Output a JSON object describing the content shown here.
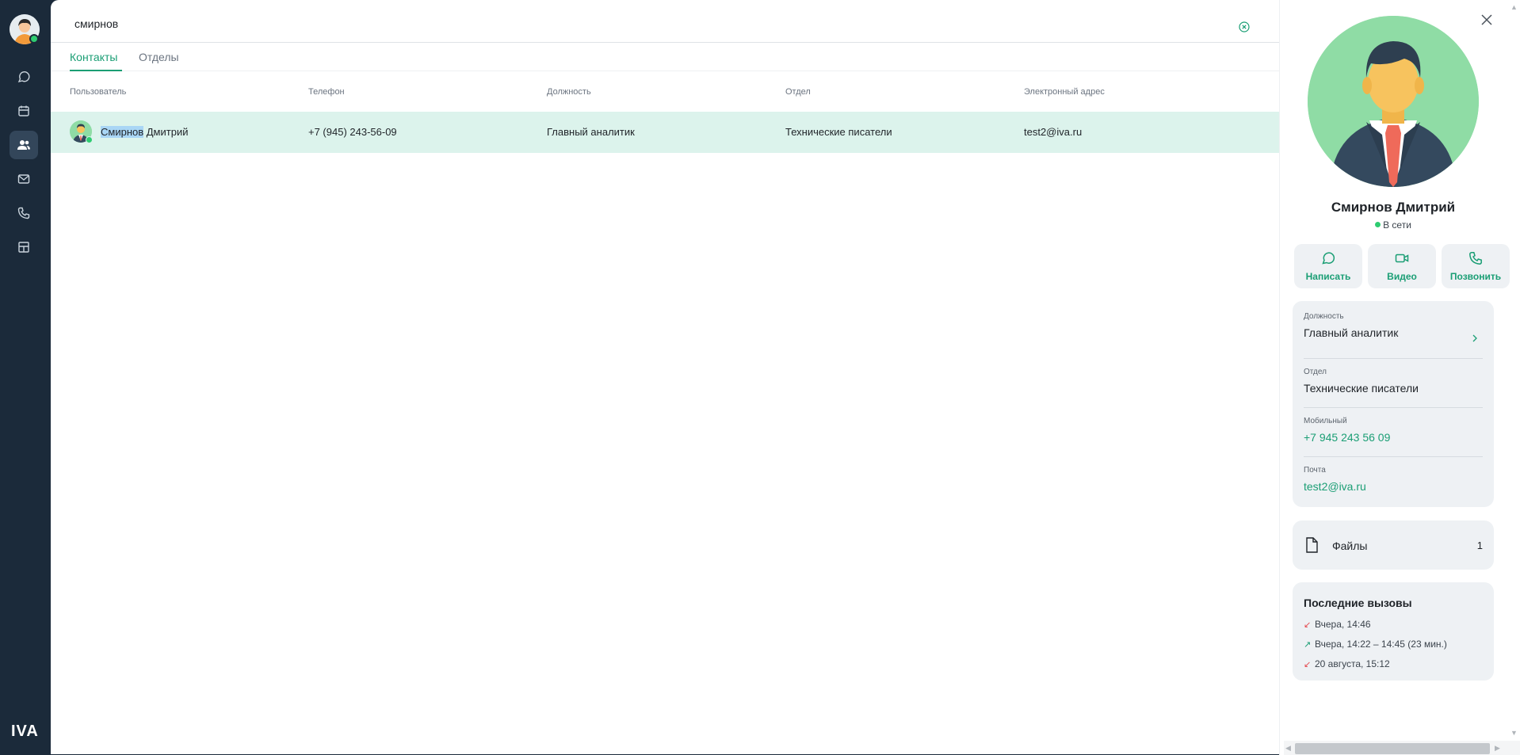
{
  "app": {
    "logo": "IVA"
  },
  "rail": {
    "items": [
      {
        "icon": "chat-icon"
      },
      {
        "icon": "calendar-icon"
      },
      {
        "icon": "contacts-icon",
        "active": true
      },
      {
        "icon": "mail-icon"
      },
      {
        "icon": "phone-icon"
      },
      {
        "icon": "workspace-icon"
      }
    ]
  },
  "search": {
    "value": "смирнов"
  },
  "tabs": [
    {
      "label": "Контакты",
      "active": true
    },
    {
      "label": "Отделы",
      "active": false
    }
  ],
  "table": {
    "columns": [
      "Пользователь",
      "Телефон",
      "Должность",
      "Отдел",
      "Электронный адрес"
    ],
    "rows": [
      {
        "name_match": "Смирнов",
        "name_rest": " Дмитрий",
        "phone": "+7 (945) 243-56-09",
        "position": "Главный аналитик",
        "department": "Технические писатели",
        "email": "test2@iva.ru"
      }
    ]
  },
  "profile": {
    "name": "Смирнов Дмитрий",
    "status": "В сети",
    "actions": [
      {
        "label": "Написать",
        "icon": "message-icon"
      },
      {
        "label": "Видео",
        "icon": "video-icon"
      },
      {
        "label": "Позвонить",
        "icon": "phone-icon"
      }
    ],
    "fields": {
      "position_label": "Должность",
      "position": "Главный аналитик",
      "department_label": "Отдел",
      "department": "Технические писатели",
      "mobile_label": "Мобильный",
      "mobile": "+7 945 243 56 09",
      "email_label": "Почта",
      "email": "test2@iva.ru"
    },
    "files": {
      "label": "Файлы",
      "count": "1"
    },
    "calls": {
      "title": "Последние вызовы",
      "items": [
        {
          "direction": "incoming",
          "text": "Вчера, 14:46"
        },
        {
          "direction": "outgoing",
          "text": "Вчера, 14:22 – 14:45 (23 мин.)"
        },
        {
          "direction": "incoming",
          "text": "20 августа, 15:12"
        }
      ]
    }
  },
  "colors": {
    "accent": "#1a9e74",
    "rail": "#1b2a3a",
    "row_selected": "#dcf3ec",
    "online": "#2ecc71",
    "missed": "#e5484d"
  }
}
